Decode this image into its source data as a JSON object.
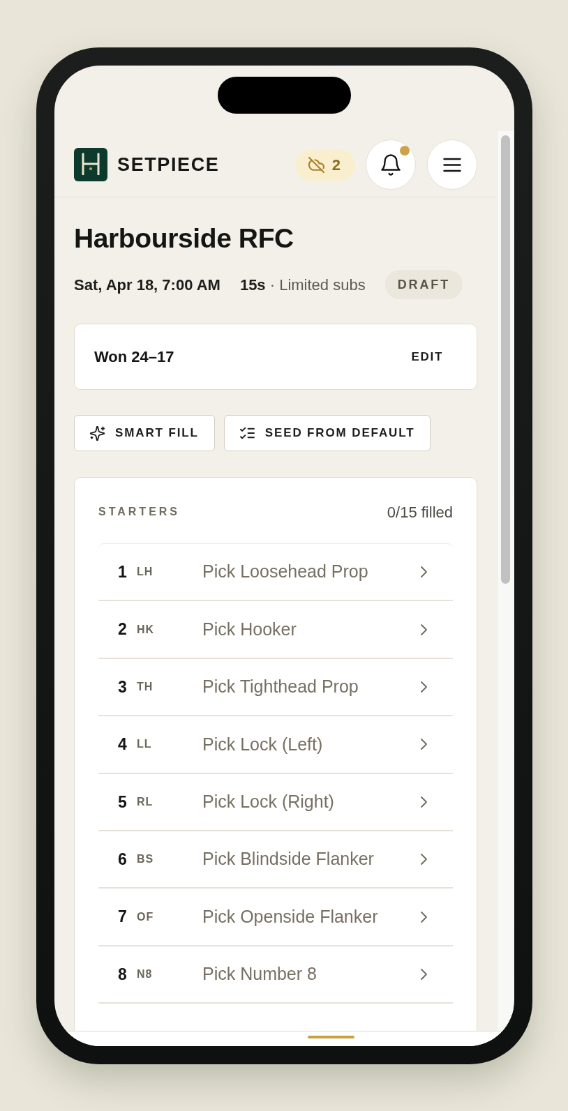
{
  "header": {
    "brand": "SETPIECE",
    "sync_badge": {
      "count": "2"
    },
    "notifications": {
      "unread": true
    }
  },
  "match": {
    "title": "Harbourside RFC",
    "datetime": "Sat, Apr 18, 7:00 AM",
    "format": "**15s** · Limited subs",
    "status": "DRAFT"
  },
  "result": {
    "score": "Won 24–17",
    "action": "EDIT"
  },
  "actions": [
    {
      "kind": "smart_fill",
      "label": "SMART FILL"
    },
    {
      "kind": "seed",
      "label": "SEED FROM DEFAULT"
    }
  ],
  "starters": {
    "title": "STARTERS",
    "progress": "0/15 filled",
    "rows": [
      {
        "number": "1",
        "code": "LH",
        "label": "Pick Loosehead Prop"
      },
      {
        "number": "2",
        "code": "HK",
        "label": "Pick Hooker"
      },
      {
        "number": "3",
        "code": "TH",
        "label": "Pick Tighthead Prop"
      },
      {
        "number": "4",
        "code": "LL",
        "label": "Pick Lock (Left)"
      },
      {
        "number": "5",
        "code": "RL",
        "label": "Pick Lock (Right)"
      },
      {
        "number": "6",
        "code": "BS",
        "label": "Pick Blindside Flanker"
      },
      {
        "number": "7",
        "code": "OF",
        "label": "Pick Openside Flanker"
      },
      {
        "number": "8",
        "code": "N8",
        "label": "Pick Number 8"
      }
    ]
  }
}
